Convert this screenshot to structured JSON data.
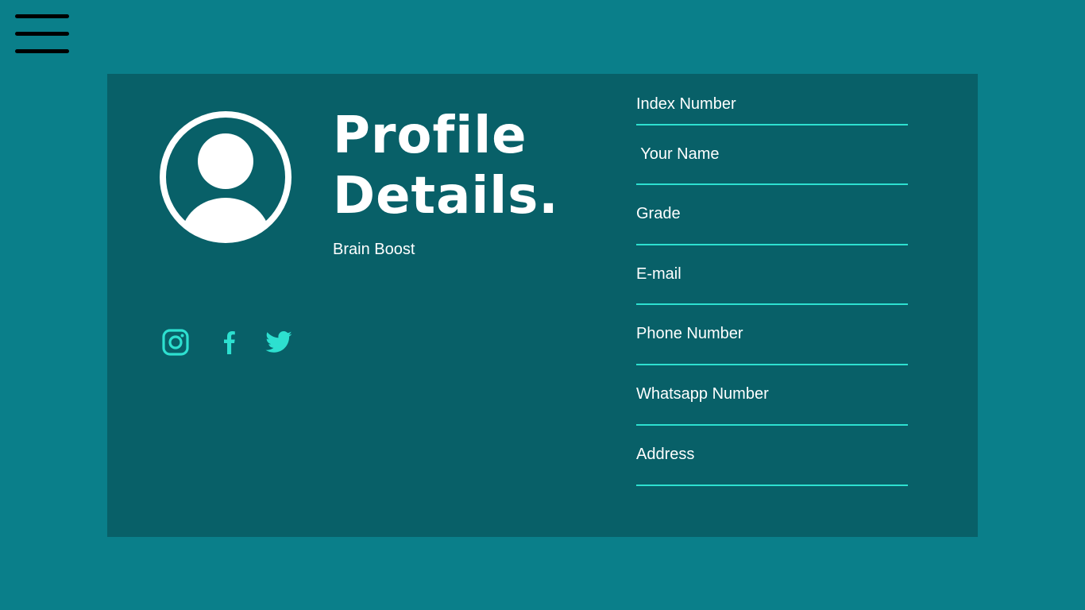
{
  "menu": {
    "icon": "hamburger-menu-icon"
  },
  "profile": {
    "title_line1": "Profile",
    "title_line2": "Details.",
    "subtitle": "Brain Boost",
    "avatar_icon": "user-avatar-icon"
  },
  "social": [
    {
      "name": "instagram-icon"
    },
    {
      "name": "facebook-icon"
    },
    {
      "name": "twitter-icon"
    }
  ],
  "form": {
    "fields": [
      {
        "label": "Index Number"
      },
      {
        "label": " Your Name"
      },
      {
        "label": "Grade"
      },
      {
        "label": "E-mail"
      },
      {
        "label": "Phone Number"
      },
      {
        "label": "Whatsapp Number"
      },
      {
        "label": "Address"
      }
    ]
  },
  "colors": {
    "background": "#0a7f8a",
    "card": "#086068",
    "accent": "#2de0d0",
    "text": "#ffffff"
  }
}
